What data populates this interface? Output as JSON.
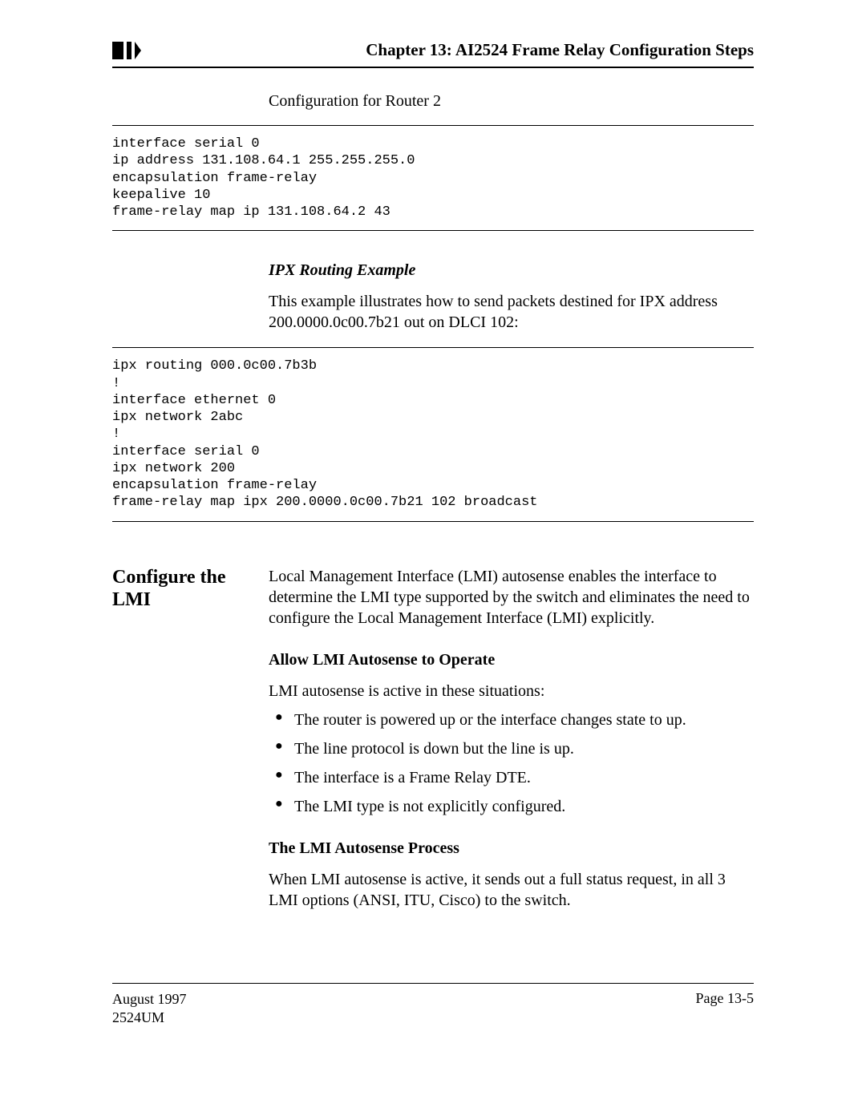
{
  "header": {
    "chapter_title": "Chapter 13: AI2524 Frame Relay Configuration Steps"
  },
  "section1": {
    "config_title": "Configuration for Router 2",
    "code": "interface serial 0\nip address 131.108.64.1 255.255.255.0\nencapsulation frame-relay\nkeepalive 10\nframe-relay map ip 131.108.64.2 43"
  },
  "section2": {
    "heading": "IPX Routing Example",
    "para": "This example illustrates how to send packets destined for IPX address 200.0000.0c00.7b21 out on DLCI 102:",
    "code": "ipx routing 000.0c00.7b3b\n!\ninterface ethernet 0\nipx network 2abc\n!\ninterface serial 0\nipx network 200\nencapsulation frame-relay\nframe-relay map ipx 200.0000.0c00.7b21 102 broadcast"
  },
  "section3": {
    "side_heading": "Configure the LMI",
    "intro": "Local Management Interface (LMI) autosense enables the interface to determine the LMI type supported by the switch and eliminates the need to configure the Local Management Interface (LMI) explicitly.",
    "sub1_heading": "Allow LMI Autosense to Operate",
    "sub1_para": "LMI autosense is active in these situations:",
    "bullets": [
      "The router is powered up or the interface changes state to up.",
      "The line protocol is down but the line is up.",
      "The interface is a Frame Relay DTE.",
      "The LMI type is not explicitly configured."
    ],
    "sub2_heading": "The LMI Autosense Process",
    "sub2_para": "When LMI autosense is active, it sends out a full status request, in all 3 LMI options (ANSI, ITU, Cisco) to the switch."
  },
  "footer": {
    "date": "August 1997",
    "doc": "2524UM",
    "page": "Page 13-5"
  }
}
